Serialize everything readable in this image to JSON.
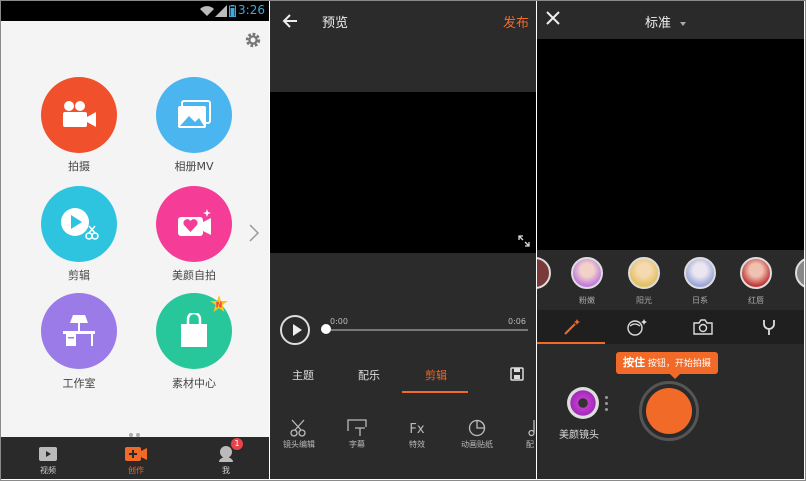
{
  "colors": {
    "accent": "#f26a28",
    "dark_bg": "#2b2b2b",
    "status_time": "#3fa9dd"
  },
  "panel1": {
    "status_time": "3:26",
    "menu": [
      {
        "label": "拍摄",
        "icon": "movie-camera-icon",
        "color": "#f0502c"
      },
      {
        "label": "相册MV",
        "icon": "photo-album-icon",
        "color": "#4bb5f0"
      },
      {
        "label": "剪辑",
        "icon": "play-scissors-icon",
        "color": "#2ec4e0"
      },
      {
        "label": "美颜自拍",
        "icon": "heart-camera-icon",
        "color": "#f53c97"
      },
      {
        "label": "工作室",
        "icon": "desk-lamp-icon",
        "color": "#9b7be8"
      },
      {
        "label": "素材中心",
        "icon": "shopping-bag-icon",
        "color": "#27c79b"
      }
    ],
    "nav": [
      {
        "label": "视频",
        "icon": "video-icon"
      },
      {
        "label": "创作",
        "icon": "create-plus-icon"
      },
      {
        "label": "我",
        "icon": "profile-icon"
      }
    ],
    "badge": "1",
    "bag_badge": "N"
  },
  "panel2": {
    "title": "预览",
    "publish": "发布",
    "time_start": "0:00",
    "time_end": "0:06",
    "tabs": [
      "主题",
      "配乐",
      "剪辑"
    ],
    "tools": [
      {
        "label": "镜头编辑",
        "icon": "scissors-icon"
      },
      {
        "label": "字幕",
        "icon": "subtitle-icon"
      },
      {
        "label": "特效",
        "icon": "fx-icon"
      },
      {
        "label": "动画贴纸",
        "icon": "sticker-icon"
      },
      {
        "label": "配",
        "icon": "music-note-icon"
      }
    ]
  },
  "panel3": {
    "mode": "标准",
    "filters": [
      "",
      "粉嫩",
      "阳光",
      "日系",
      "红唇"
    ],
    "tip_bold": "按住",
    "tip_rest": " 按钮，开始拍摄",
    "beauty_label": "美颜镜头"
  }
}
